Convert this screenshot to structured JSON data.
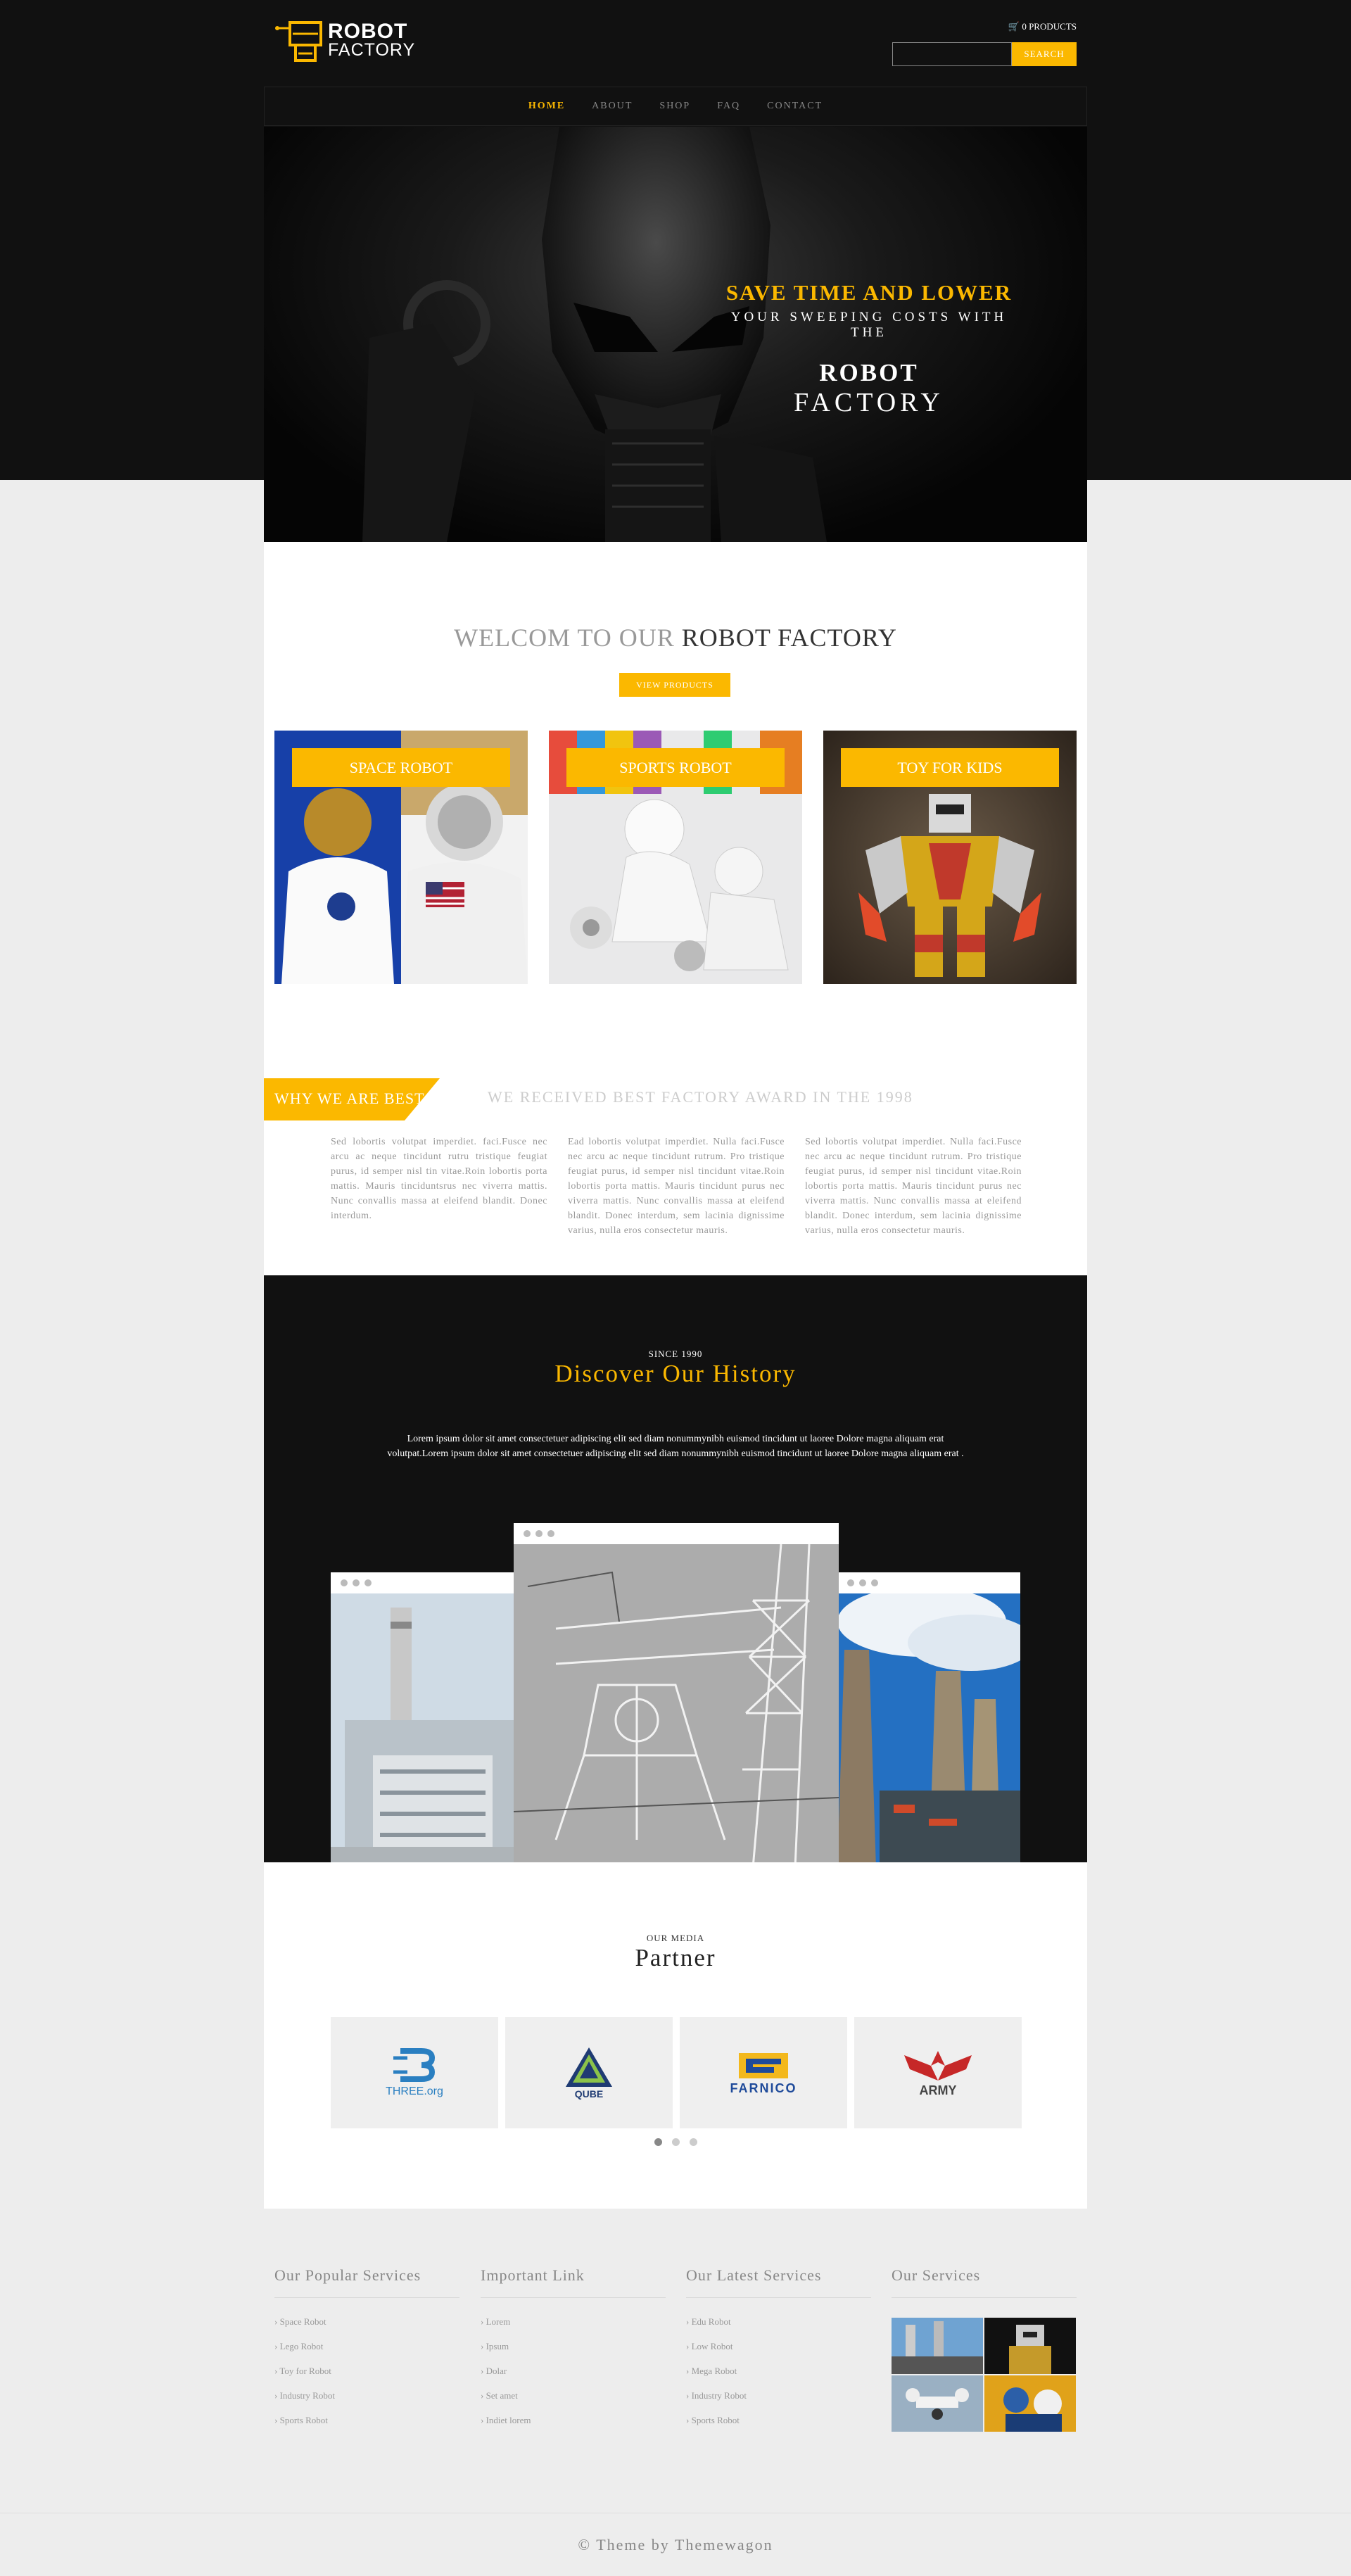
{
  "brand": {
    "line1": "ROBOT",
    "line2": "FACTORY"
  },
  "header": {
    "cart": "0 PRODUCTS",
    "search_placeholder": "",
    "search_label": "SEARCH"
  },
  "nav": [
    "HOME",
    "ABOUT",
    "SHOP",
    "FAQ",
    "CONTACT"
  ],
  "hero": {
    "line1": "SAVE TIME AND LOWER",
    "line2": "YOUR SWEEPING COSTS WITH THE",
    "line3": "ROBOT",
    "line4": "FACTORY"
  },
  "welcome": {
    "light": "WELCOM TO OUR ",
    "dark": "ROBOT FACTORY",
    "button": "VIEW PRODUCTS"
  },
  "categories": [
    "SPACE ROBOT",
    "SPORTS ROBOT",
    "TOY FOR KIDS"
  ],
  "why": {
    "tag": "WHY WE ARE BEST",
    "award": "WE RECEIVED BEST FACTORY AWARD IN THE 1998",
    "cols": [
      "Sed lobortis volutpat imperdiet. faci.Fusce nec arcu ac neque tincidunt rutru tristique feugiat purus, id semper nisl tin vitae.Roin lobortis porta mattis. Mauris tinciduntsrus nec viverra mattis. Nunc convallis massa at eleifend blandit. Donec interdum.",
      "Ead lobortis volutpat imperdiet. Nulla faci.Fusce nec arcu ac neque tincidunt rutrum. Pro tristique feugiat purus, id semper nisl tincidunt vitae.Roin lobortis porta mattis. Mauris tincidunt purus nec viverra mattis. Nunc convallis massa at eleifend blandit. Donec interdum, sem lacinia dignissime varius, nulla eros consectetur mauris.",
      "Sed lobortis volutpat imperdiet. Nulla faci.Fusce nec arcu ac neque tincidunt rutrum. Pro tristique feugiat purus, id semper nisl tincidunt vitae.Roin lobortis porta mattis. Mauris tincidunt purus nec viverra mattis. Nunc convallis massa at eleifend blandit. Donec interdum, sem lacinia dignissime varius, nulla eros consectetur mauris."
    ]
  },
  "history": {
    "since": "SINCE 1990",
    "title": "Discover Our History",
    "desc": "Lorem ipsum dolor sit amet consectetuer adipiscing elit sed diam nonummynibh euismod tincidunt ut laoree Dolore magna aliquam erat volutpat.Lorem ipsum dolor sit amet consectetuer adipiscing elit sed diam nonummynibh euismod tincidunt ut laoree Dolore magna aliquam erat ."
  },
  "partner": {
    "kicker": "OUR MEDIA",
    "title": "Partner",
    "logos": [
      {
        "name": "THREE.org",
        "color": "#2a7fc1"
      },
      {
        "name": "QUBE",
        "color": "#1f3b73"
      },
      {
        "name": "FARNICO",
        "color": "#1e4a9a"
      },
      {
        "name": "ARMY",
        "color": "#444444"
      }
    ]
  },
  "footer": {
    "popular": {
      "title": "Our Popular Services",
      "items": [
        "Space Robot",
        "Lego Robot",
        "Toy for Robot",
        "Industry Robot",
        "Sports Robot"
      ]
    },
    "important": {
      "title": "Important Link",
      "items": [
        "Lorem",
        "Ipsum",
        "Dolar",
        "Set amet",
        "Indiet lorem"
      ]
    },
    "latest": {
      "title": "Our Latest Services",
      "items": [
        "Edu Robot",
        "Low Robot",
        "Mega Robot",
        "Industry Robot",
        "Sports Robot"
      ]
    },
    "services": {
      "title": "Our Services"
    }
  },
  "copyright": "© Theme by Themewagon",
  "colors": {
    "accent": "#fbb800",
    "dark": "#111111"
  }
}
